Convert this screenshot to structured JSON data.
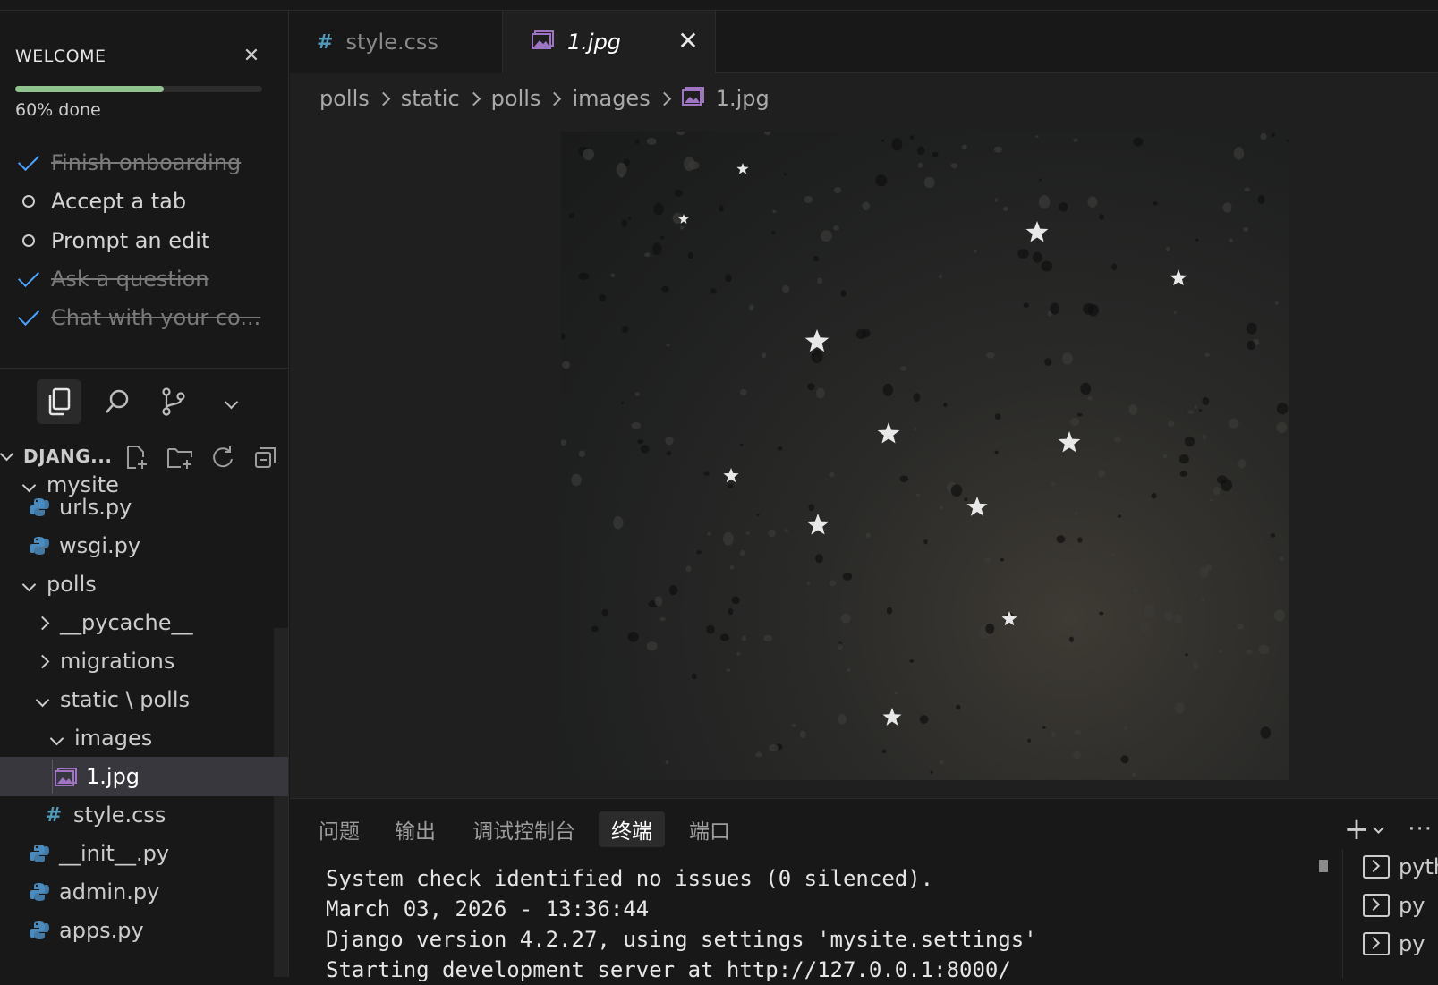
{
  "welcome": {
    "title": "WELCOME",
    "progress_text": "60% done",
    "progress_fraction": 0.6,
    "items": [
      {
        "label": "Finish onboarding",
        "done": true
      },
      {
        "label": "Accept a tab",
        "done": false
      },
      {
        "label": "Prompt an edit",
        "done": false
      },
      {
        "label": "Ask a question",
        "done": true
      },
      {
        "label": "Chat with your co...",
        "done": true
      }
    ]
  },
  "explorer": {
    "title": "DJANG...",
    "tree": [
      {
        "label": "mysite",
        "kind": "folder-open"
      },
      {
        "label": "urls.py",
        "kind": "python"
      },
      {
        "label": "wsgi.py",
        "kind": "python"
      },
      {
        "label": "polls",
        "kind": "folder-open"
      },
      {
        "label": "__pycache__",
        "kind": "folder-closed"
      },
      {
        "label": "migrations",
        "kind": "folder-closed"
      },
      {
        "label": "static \\ polls",
        "kind": "folder-open"
      },
      {
        "label": "images",
        "kind": "folder-open"
      },
      {
        "label": "1.jpg",
        "kind": "image"
      },
      {
        "label": "style.css",
        "kind": "css"
      },
      {
        "label": "__init__.py",
        "kind": "python"
      },
      {
        "label": "admin.py",
        "kind": "python"
      },
      {
        "label": "apps.py",
        "kind": "python"
      }
    ]
  },
  "tabs": [
    {
      "label": "style.css",
      "active": false,
      "icon": "hash-icon"
    },
    {
      "label": "1.jpg",
      "active": true,
      "icon": "image-icon"
    }
  ],
  "breadcrumbs": [
    "polls",
    "static",
    "polls",
    "images",
    "1.jpg"
  ],
  "panel": {
    "tabs": [
      "问题",
      "输出",
      "调试控制台",
      "终端",
      "端口"
    ],
    "active_tab": "终端",
    "terminal_lines": [
      "System check identified no issues (0 silenced).",
      "March 03, 2026 - 13:36:44",
      "Django version 4.2.27, using settings 'mysite.settings'",
      "Starting development server at http://127.0.0.1:8000/"
    ],
    "terminals": [
      "pyth",
      "py",
      "py"
    ]
  },
  "colors": {
    "accent": "#4aa3ff",
    "progress": "#8fc48f",
    "python": "#4b8bbe",
    "image_icon": "#a074c4",
    "css_hash": "#519aba"
  }
}
